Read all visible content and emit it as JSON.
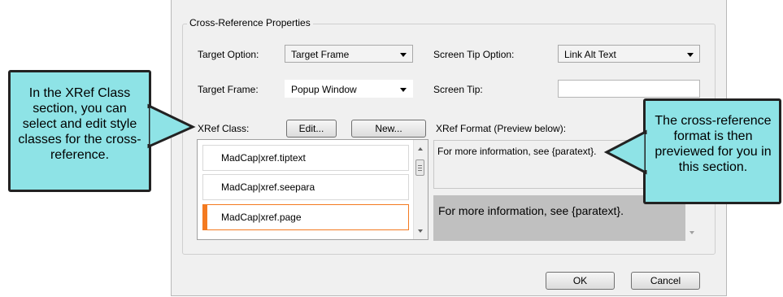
{
  "dialog": {
    "group_title": "Cross-Reference Properties",
    "target_option": {
      "label": "Target Option:",
      "value": "Target Frame"
    },
    "screen_tip_option": {
      "label": "Screen Tip Option:",
      "value": "Link Alt Text"
    },
    "target_frame": {
      "label": "Target Frame:",
      "value": "Popup Window"
    },
    "screen_tip": {
      "label": "Screen Tip:",
      "value": ""
    },
    "xref_class": {
      "label": "XRef Class:",
      "edit_label": "Edit...",
      "new_label": "New...",
      "items": [
        "MadCap|xref.tiptext",
        "MadCap|xref.seepara",
        "MadCap|xref.page"
      ],
      "selected_index": 2
    },
    "xref_format": {
      "label": "XRef Format (Preview below):",
      "value": "For more information, see {paratext}.",
      "preview": "For more information, see {paratext}."
    },
    "ok_label": "OK",
    "cancel_label": "Cancel"
  },
  "callouts": {
    "left": "In the XRef Class section, you can select and edit style classes for the cross-reference.",
    "right": "The cross-reference format is then previewed for you in this section."
  },
  "colors": {
    "callout_fill": "#8ee3e6",
    "selection_accent": "#f47a20",
    "preview_bg": "#c0c0c0"
  }
}
